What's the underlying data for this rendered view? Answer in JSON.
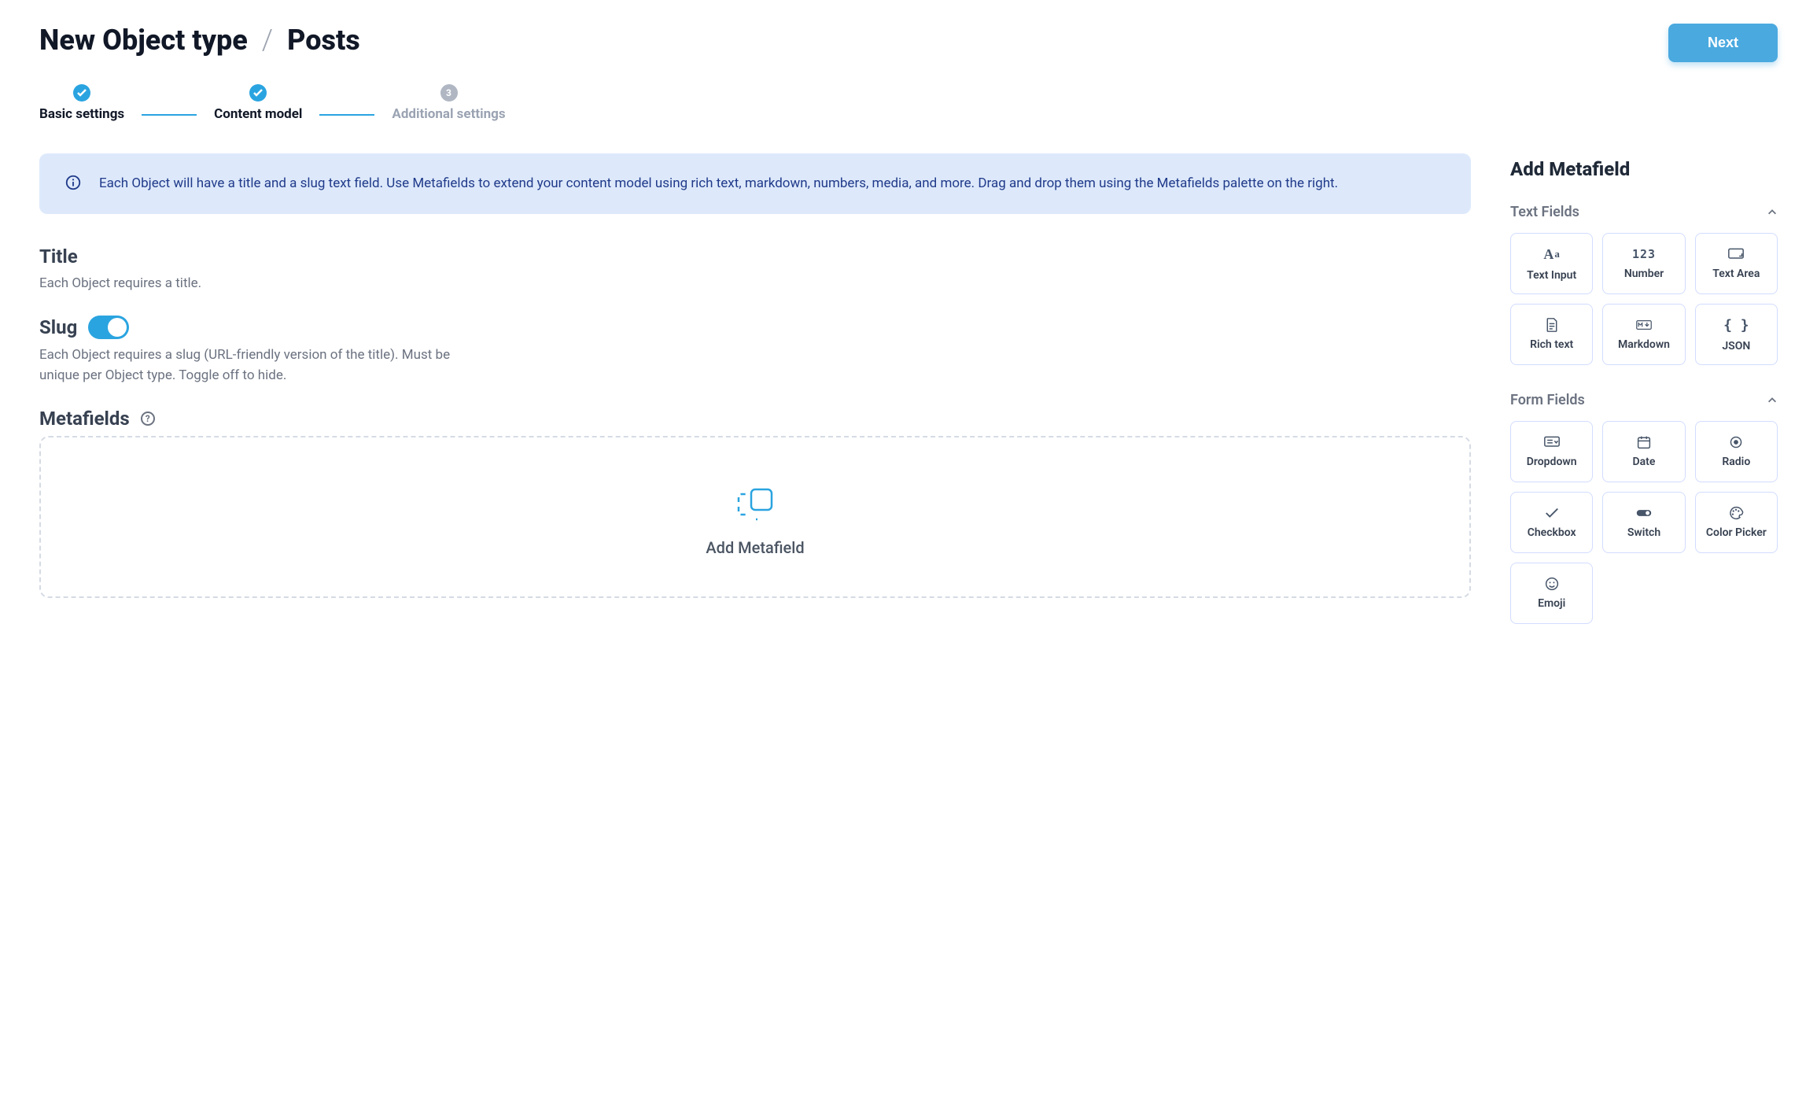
{
  "header": {
    "title_prefix": "New Object type",
    "separator": "/",
    "title_name": "Posts",
    "next_button": "Next"
  },
  "stepper": {
    "steps": [
      {
        "label": "Basic settings",
        "status": "done"
      },
      {
        "label": "Content model",
        "status": "done"
      },
      {
        "label": "Additional settings",
        "status": "todo",
        "number": "3"
      }
    ]
  },
  "info_banner": "Each Object will have a title and a slug text field. Use Metafields to extend your content model using rich text, markdown, numbers, media, and more. Drag and drop them using the Metafields palette on the right.",
  "title_section": {
    "heading": "Title",
    "desc": "Each Object requires a title."
  },
  "slug_section": {
    "heading": "Slug",
    "toggle_on": true,
    "desc": "Each Object requires a slug (URL-friendly version of the title). Must be unique per Object type. Toggle off to hide."
  },
  "metafields_section": {
    "heading": "Metafields",
    "help_symbol": "?",
    "dropzone_label": "Add Metafield"
  },
  "palette": {
    "heading": "Add Metafield",
    "groups": [
      {
        "title": "Text Fields",
        "items": [
          {
            "key": "text-input",
            "label": "Text Input",
            "icon": "Aa"
          },
          {
            "key": "number",
            "label": "Number",
            "icon": "123"
          },
          {
            "key": "text-area",
            "label": "Text Area",
            "icon": "textarea-svg"
          },
          {
            "key": "rich-text",
            "label": "Rich text",
            "icon": "richtext-svg"
          },
          {
            "key": "markdown",
            "label": "Markdown",
            "icon": "markdown-svg"
          },
          {
            "key": "json",
            "label": "JSON",
            "icon": "{ }"
          }
        ]
      },
      {
        "title": "Form Fields",
        "items": [
          {
            "key": "dropdown",
            "label": "Dropdown",
            "icon": "dropdown-svg"
          },
          {
            "key": "date",
            "label": "Date",
            "icon": "date-svg"
          },
          {
            "key": "radio",
            "label": "Radio",
            "icon": "radio-svg"
          },
          {
            "key": "checkbox",
            "label": "Checkbox",
            "icon": "check-svg"
          },
          {
            "key": "switch",
            "label": "Switch",
            "icon": "switch-svg"
          },
          {
            "key": "color-picker",
            "label": "Color Picker",
            "icon": "color-svg"
          },
          {
            "key": "emoji",
            "label": "Emoji",
            "icon": "emoji-svg"
          }
        ]
      }
    ]
  }
}
